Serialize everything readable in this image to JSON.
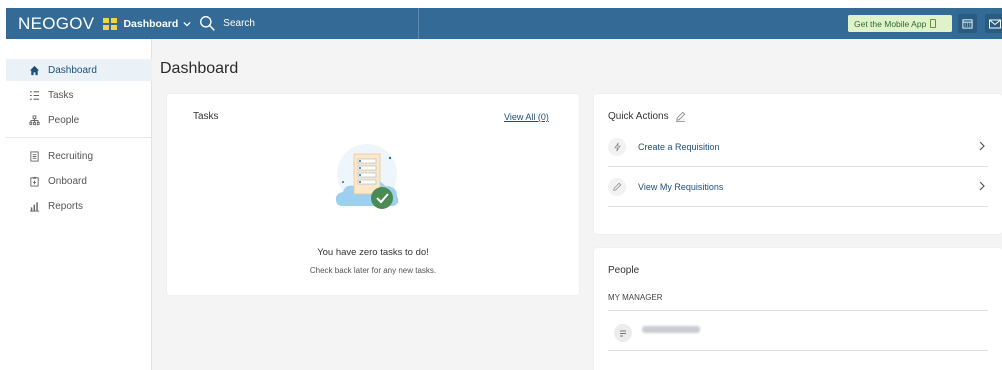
{
  "header": {
    "brand": "NEOGOV",
    "dashboard_menu": "Dashboard",
    "search_label": "Search",
    "mobile_app_button": "Get the Mobile App"
  },
  "sidebar": {
    "items": [
      {
        "label": "Dashboard",
        "icon": "home-icon",
        "active": true
      },
      {
        "label": "Tasks",
        "icon": "tasks-icon"
      },
      {
        "label": "People",
        "icon": "people-icon"
      },
      {
        "label": "Recruiting",
        "icon": "recruiting-icon"
      },
      {
        "label": "Onboard",
        "icon": "onboard-icon"
      },
      {
        "label": "Reports",
        "icon": "reports-icon"
      }
    ]
  },
  "main": {
    "title": "Dashboard",
    "tasks": {
      "title": "Tasks",
      "view_all": "View All (0)",
      "empty_title": "You have zero tasks to do!",
      "empty_subtitle": "Check back later for any new tasks."
    },
    "quick_actions": {
      "title": "Quick Actions",
      "items": [
        {
          "label": "Create a Requisition",
          "icon": "lightning-icon"
        },
        {
          "label": "View My Requisitions",
          "icon": "pencil-icon"
        }
      ]
    },
    "people": {
      "title": "People",
      "manager_label": "MY MANAGER"
    }
  },
  "colors": {
    "topbar": "#336b96",
    "accent_text": "#1f4e79",
    "logo_grid": "#f2d24b",
    "mobile_btn_bg": "#dff2c9"
  }
}
